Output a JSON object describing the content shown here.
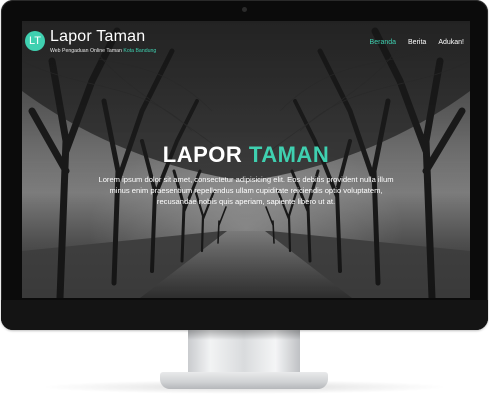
{
  "site": {
    "logo_text": "LT",
    "title": "Lapor Taman",
    "subtitle_prefix": "Web Pengaduan Online Taman ",
    "subtitle_highlight": "Kota Bandung"
  },
  "nav": {
    "items": [
      {
        "label": "Beranda",
        "active": true
      },
      {
        "label": "Berita",
        "active": false
      },
      {
        "label": "Adukan!",
        "active": false
      }
    ]
  },
  "hero": {
    "title_main": "LAPOR ",
    "title_accent": "TAMAN",
    "text": "Lorem ipsum dolor sit amet, consectetur adipisicing elit. Eos debitis provident nulla illum minus enim praesentium repellendus ullam cupiditate reiciendis optio voluptatem, recusandae nobis quis aperiam, sapiente libero ut at."
  },
  "colors": {
    "accent": "#3fd0b0",
    "text": "#ffffff",
    "bezel": "#0b0b0b"
  }
}
